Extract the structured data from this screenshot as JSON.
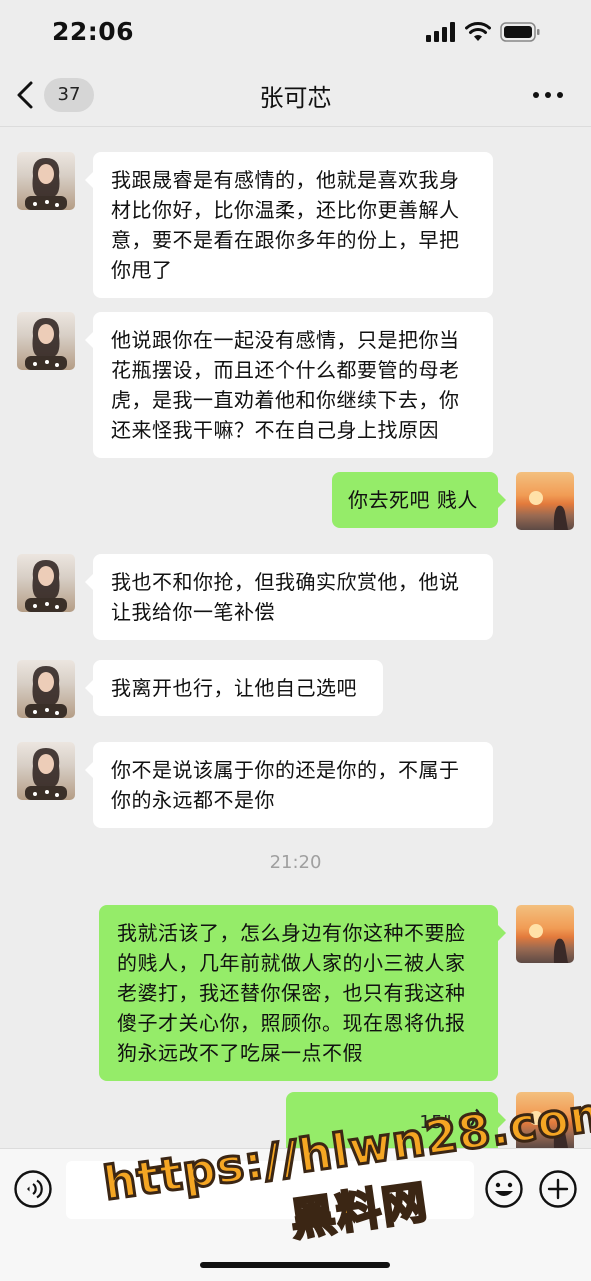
{
  "status_bar": {
    "time": "22:06"
  },
  "nav": {
    "unread_count": "37",
    "title": "张可芯",
    "more": "•••"
  },
  "messages": [
    {
      "side": "left",
      "avatar": "avatar-girl",
      "text": "我跟晟睿是有感情的，他就是喜欢我身材比你好，比你温柔，还比你更善解人意，要不是看在跟你多年的份上，早把你甩了"
    },
    {
      "side": "left",
      "avatar": "avatar-girl",
      "text": "他说跟你在一起没有感情，只是把你当花瓶摆设，而且还个什么都要管的母老虎，是我一直劝着他和你继续下去，你还来怪我干嘛？不在自己身上找原因"
    },
    {
      "side": "right",
      "avatar": "avatar-sunset",
      "text": "你去死吧 贱人"
    },
    {
      "side": "left",
      "avatar": "avatar-girl",
      "text": "我也不和你抢，但我确实欣赏他，他说让我给你一笔补偿"
    },
    {
      "side": "left",
      "avatar": "avatar-girl",
      "text": "我离开也行，让他自己选吧"
    },
    {
      "side": "left",
      "avatar": "avatar-girl",
      "text": "你不是说该属于你的还是你的，不属于你的永远都不是你"
    },
    {
      "side": "right",
      "avatar": "avatar-sunset",
      "text": "我就活该了，怎么身边有你这种不要脸的贱人，几年前就做人家的小三被人家老婆打，我还替你保密，也只有我这种傻子才关心你，照顾你。现在恩将仇报狗永远改不了吃屎一点不假"
    }
  ],
  "timestamp": "21:20",
  "voice_message": {
    "duration": "15\""
  },
  "watermark": {
    "url": "https://hlwn28.com",
    "name": "黑料网"
  },
  "colors": {
    "background": "#ededed",
    "bubble_self": "#95ec69",
    "bubble_other": "#ffffff",
    "watermark": "#f5a623"
  }
}
